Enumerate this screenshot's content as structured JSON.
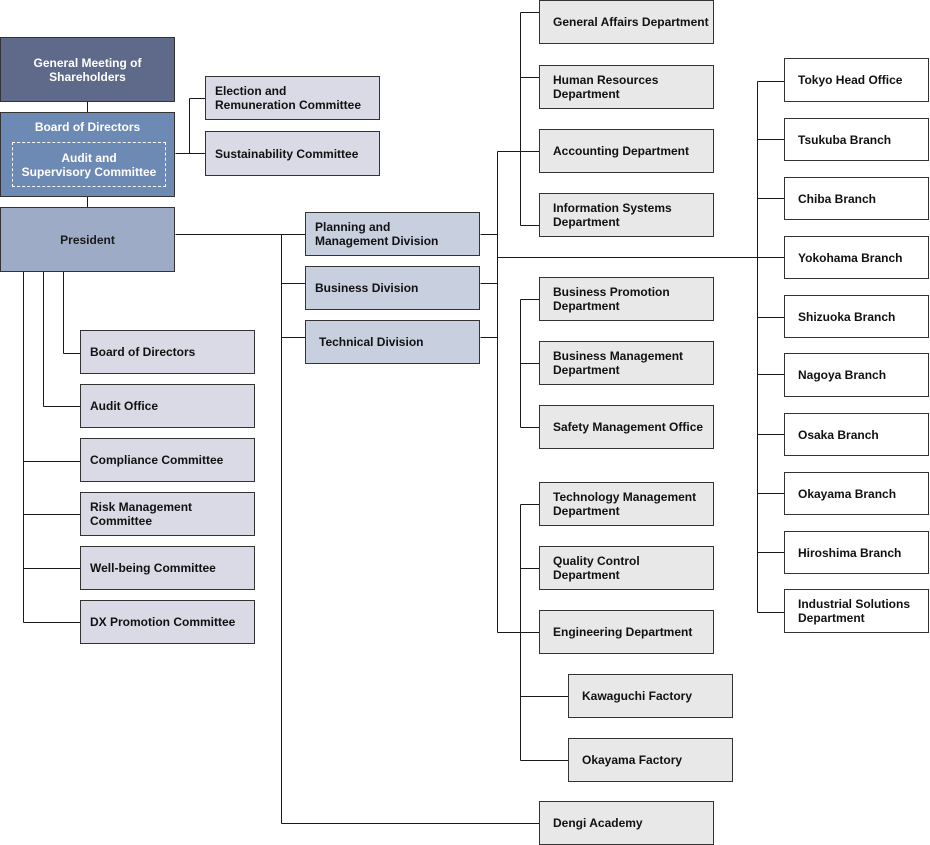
{
  "governance": {
    "shareholders": "General Meeting of\nShareholders",
    "board": "Board of Directors",
    "audit_committee": "Audit and\nSupervisory Committee",
    "president": "President",
    "board_committees": [
      "Election and\nRemuneration Committee",
      "Sustainability Committee"
    ]
  },
  "president_units": [
    "Board of Directors",
    "Audit Office",
    "Compliance Committee",
    "Risk Management\nCommittee",
    "Well-being Committee",
    "DX Promotion Committee"
  ],
  "divisions": [
    {
      "name": "Planning and\nManagement Division",
      "departments": [
        "General Affairs Department",
        "Human Resources\nDepartment",
        "Accounting Department",
        "Information Systems\nDepartment"
      ]
    },
    {
      "name": "Business Division",
      "departments": [
        "Business Promotion\nDepartment",
        "Business Management\nDepartment",
        "Safety Management Office"
      ]
    },
    {
      "name": "Technical Division",
      "departments": [
        "Technology Management\nDepartment",
        "Quality Control\nDepartment",
        "Engineering Department"
      ],
      "factories": [
        "Kawaguchi Factory",
        "Okayama Factory"
      ]
    }
  ],
  "dengi_academy": "Dengi Academy",
  "branches": [
    "Tokyo Head Office",
    "Tsukuba Branch",
    "Chiba Branch",
    "Yokohama Branch",
    "Shizuoka Branch",
    "Nagoya Branch",
    "Osaka Branch",
    "Okayama Branch",
    "Hiroshima Branch",
    "Industrial Solutions\nDepartment"
  ],
  "colors": {
    "shareholders_fill": "#5f6a8a",
    "board_fill": "#6d8ab5",
    "president_fill": "#9eabc7",
    "committee_fill": "#dadae6",
    "division_fill": "#c8d0e0",
    "department_fill": "#e8e8e8",
    "branch_fill": "#ffffff",
    "line": "#1a1a1a"
  }
}
